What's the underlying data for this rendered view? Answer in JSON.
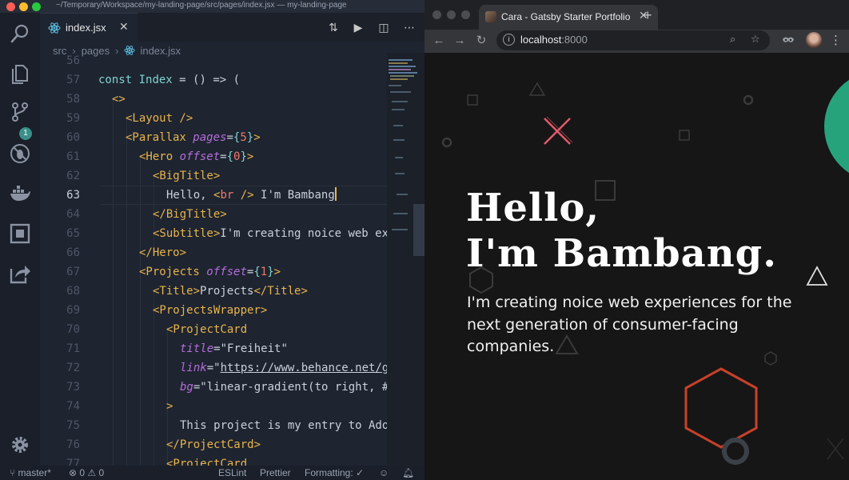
{
  "editor": {
    "window_title": "~/Temporary/Workspace/my-landing-page/src/pages/index.jsx — my-landing-page",
    "tab": {
      "label": "index.jsx",
      "close": "✕"
    },
    "breadcrumb": [
      "src",
      "pages",
      "index.jsx"
    ],
    "scm_badge": "1",
    "line_numbers": [
      "56",
      "57",
      "58",
      "59",
      "60",
      "61",
      "62",
      "63",
      "64",
      "65",
      "66",
      "67",
      "68",
      "69",
      "70",
      "71",
      "72",
      "73",
      "74",
      "75",
      "76",
      "77"
    ],
    "current_line": "63",
    "statusbar": {
      "branch": "master*",
      "errors": "0",
      "warnings": "0",
      "eslint": "ESLint",
      "prettier": "Prettier",
      "formatting": "Formatting: ✓"
    }
  },
  "browser": {
    "tab_title": "Cara - Gatsby Starter Portfolio",
    "url_host": "localhost",
    "url_port": ":8000",
    "hero": {
      "title_line1": "Hello,",
      "title_line2": "I'm Bambang.",
      "subtitle": "I'm creating noice web experiences for the next generation of consumer-facing companies."
    }
  },
  "colors": {
    "editor_bg": "#1e2430",
    "tag": "#e8b44c",
    "attribute": "#b56ddb",
    "number": "#f07a6b",
    "page_bg": "#161616",
    "hero_text": "#ffffff",
    "shape_teal": "#27a37c",
    "shape_pink": "#e05a6b",
    "shape_orange": "#c8412a"
  }
}
